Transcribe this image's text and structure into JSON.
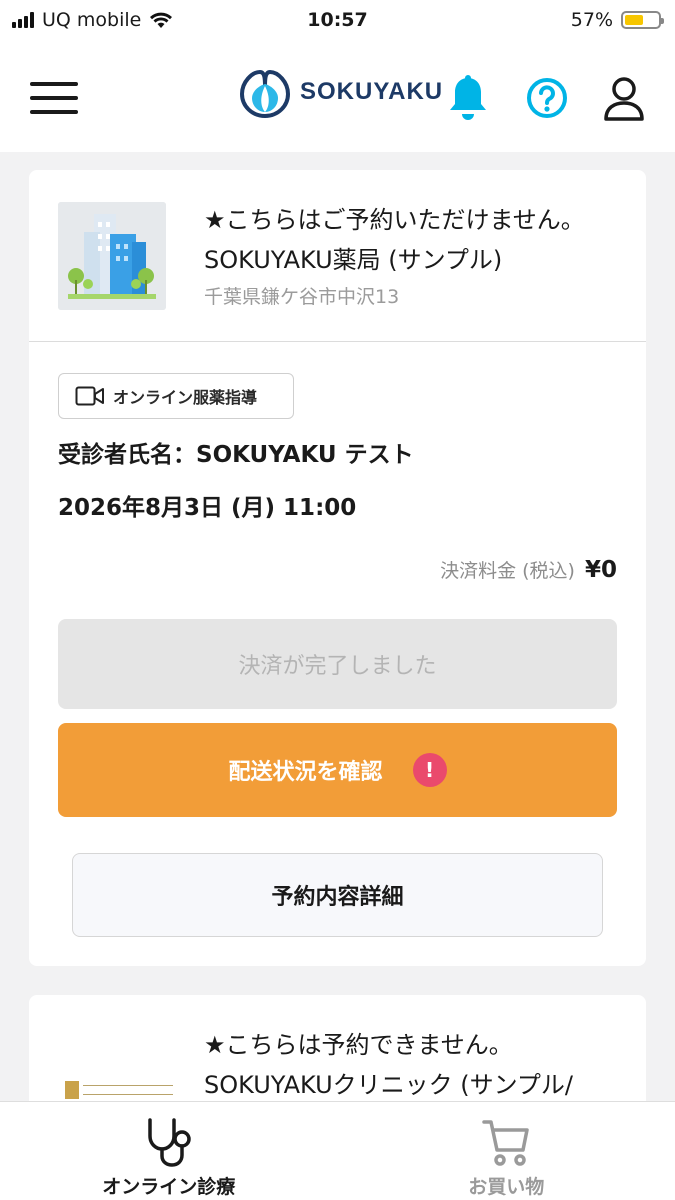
{
  "status_bar": {
    "carrier": "UQ mobile",
    "time": "10:57",
    "battery_percent": "57%",
    "battery_level": 0.57
  },
  "header": {
    "logo_text": "SOKUYAKU",
    "icons": [
      "menu-icon",
      "bell-icon",
      "help-icon",
      "user-icon"
    ],
    "accent_color": "#00b4e6"
  },
  "reservation": {
    "notice": "★こちらはご予約いただけません。",
    "pharmacy_name": "SOKUYAKU薬局 (サンプル)",
    "address": "千葉県鎌ケ谷市中沢13",
    "tag_label": "オンライン服薬指導",
    "patient": "受診者氏名：SOKUYAKU テスト",
    "datetime": "2026年8月3日 (月) 11:00",
    "fee_label": "決済料金 (税込)",
    "fee_value": "¥0",
    "payment_done_label": "決済が完了しました",
    "delivery_label": "配送状況を確認",
    "delivery_badge": "!",
    "detail_label": "予約内容詳細",
    "colors": {
      "delivery_button": "#f29d38",
      "badge": "#ea4a6c"
    }
  },
  "reservation2": {
    "notice": "★こちらは予約できません。",
    "clinic_name": "SOKUYAKUクリニック (サンプル/"
  },
  "tabbar": {
    "tabs": [
      {
        "label": "オンライン診療",
        "icon": "stethoscope-icon",
        "active": true
      },
      {
        "label": "お買い物",
        "icon": "cart-icon",
        "active": false
      }
    ]
  }
}
